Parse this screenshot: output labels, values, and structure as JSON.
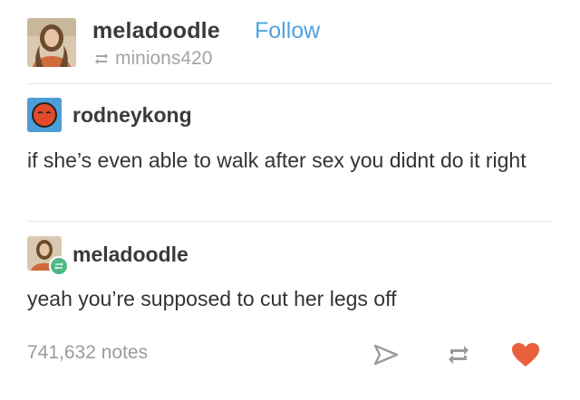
{
  "post_header": {
    "username": "meladoodle",
    "follow_label": "Follow",
    "reblogged_from": "minions420"
  },
  "thread": [
    {
      "username": "rodneykong",
      "text": "if she’s even able to walk after sex you didnt do it right"
    },
    {
      "username": "meladoodle",
      "text": "yeah you’re supposed to cut her legs off"
    }
  ],
  "footer": {
    "notes": "741,632 notes"
  },
  "colors": {
    "follow_link": "#4fa3e0",
    "like_heart": "#e8613c",
    "reblog_badge": "#4cb886",
    "rodney_avatar_bg": "#4d9ed6"
  },
  "icons": {
    "reblog_indicator": "reblog-icon",
    "share": "share-icon",
    "reblog": "reblog-icon",
    "like": "heart-icon"
  }
}
